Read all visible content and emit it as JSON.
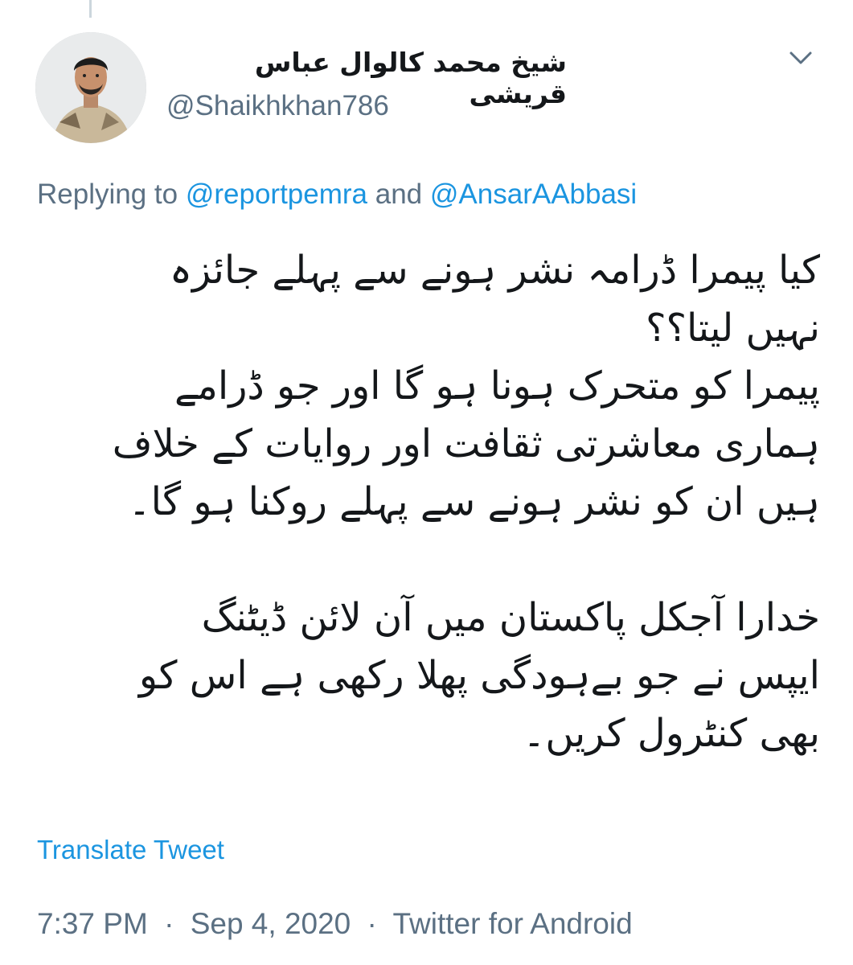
{
  "tweet": {
    "author": {
      "display_name": "شیخ محمد کالوال عباس قریشی",
      "handle": "@Shaikhkhan786",
      "avatar": "profile-photo"
    },
    "replying": {
      "prefix": "Replying to",
      "mention_1": "@reportpemra",
      "connector": "and",
      "mention_2": "@AnsarAAbbasi"
    },
    "lines": [
      "کیا پیمرا ڈرامہ نشر ہونے سے پہلے جائزہ",
      "نہیں لیتا؟؟",
      "پیمرا کو متحرک ہونا ہو گا اور جو ڈرامے",
      "ہماری معاشرتی ثقافت اور روایات کے خلاف",
      "ہیں ان کو نشر ہونے سے پہلے روکنا ہو گا۔",
      "",
      "خدارا آجکل پاکستان میں آن لائن ڈیٹنگ",
      "ایپس نے جو بےہودگی پھلا رکھی ہے اس کو",
      "بھی کنٹرول کریں۔"
    ],
    "translate_label": "Translate Tweet",
    "time": "7:37 PM",
    "date": "Sep 4, 2020",
    "source": "Twitter for Android",
    "separator": "·",
    "icons": {
      "caret": "chevron-down-icon"
    },
    "colors": {
      "link": "#1b95e0",
      "secondary": "#5b7083",
      "text": "#14171a"
    }
  }
}
